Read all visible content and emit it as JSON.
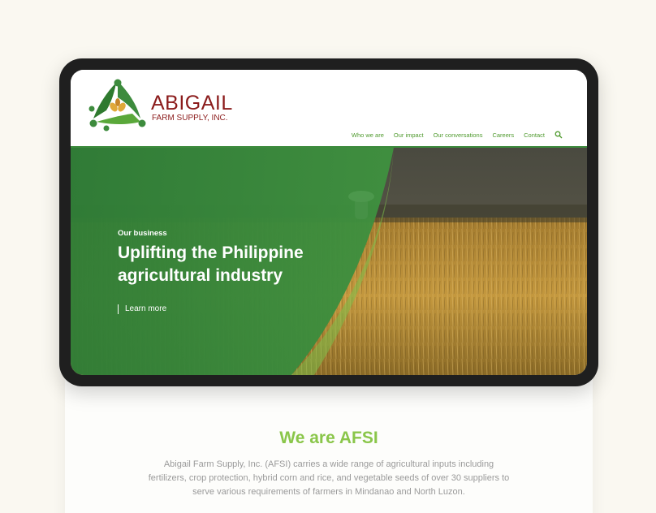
{
  "brand": {
    "name": "ABIGAIL",
    "subtitle": "FARM SUPPLY, INC."
  },
  "nav": {
    "items": [
      "Who we are",
      "Our impact",
      "Our conversations",
      "Careers",
      "Contact"
    ],
    "search_icon": "search-icon"
  },
  "hero": {
    "eyebrow": "Our business",
    "title_line1": "Uplifting the Philippine",
    "title_line2": "agricultural industry",
    "cta": "Learn more"
  },
  "about": {
    "heading": "We are AFSI",
    "body": "Abigail Farm Supply, Inc. (AFSI) carries a wide range of agricultural inputs including fertilizers, crop protection, hybrid corn and rice, and vegetable seeds of over 30 suppliers to serve various requirements of farmers in Mindanao and North Luzon."
  },
  "colors": {
    "brand_red": "#8b1b1b",
    "brand_green": "#3d8b3d",
    "accent_green": "#8ac64a",
    "background": "#faf8f1",
    "device_frame": "#1f1f1f"
  }
}
